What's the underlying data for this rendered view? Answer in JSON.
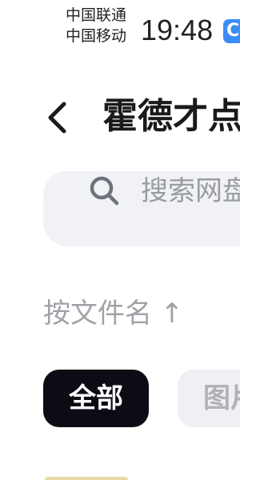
{
  "status_bar": {
    "carrier_1": "中国联通",
    "carrier_2": "中国移动",
    "time": "19:48",
    "app_icon_letter": "C"
  },
  "header": {
    "title": "霍德才点"
  },
  "search": {
    "placeholder": "搜索网盘"
  },
  "sort": {
    "label": "按文件名 ↑"
  },
  "filters": [
    {
      "label": "全部",
      "selected": true
    },
    {
      "label": "图片",
      "selected": false
    }
  ],
  "colors": {
    "chip_selected_bg": "#0c0d14",
    "chip_bg": "#eef0f4",
    "search_bg": "#f1f2f6",
    "app_icon_bg": "#3b8cf6"
  }
}
